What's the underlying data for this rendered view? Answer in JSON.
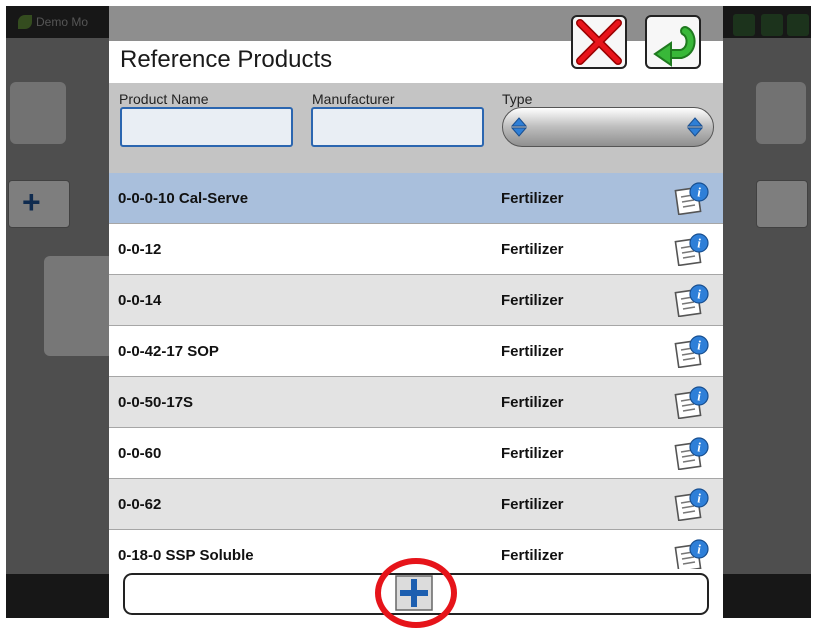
{
  "background_app": {
    "window_title": "Demo Mo"
  },
  "dialog": {
    "title": "Reference Products",
    "cancel_icon": "red-x-icon",
    "accept_icon": "green-return-arrow-icon",
    "filters": {
      "product_name_label": "Product Name",
      "product_name_value": "",
      "manufacturer_label": "Manufacturer",
      "manufacturer_value": "",
      "type_label": "Type",
      "type_value": ""
    },
    "rows": [
      {
        "name": "0-0-0-10 Cal-Serve",
        "type": "Fertilizer",
        "selected": true
      },
      {
        "name": "0-0-12",
        "type": "Fertilizer",
        "selected": false
      },
      {
        "name": "0-0-14",
        "type": "Fertilizer",
        "selected": false
      },
      {
        "name": "0-0-42-17 SOP",
        "type": "Fertilizer",
        "selected": false
      },
      {
        "name": "0-0-50-17S",
        "type": "Fertilizer",
        "selected": false
      },
      {
        "name": "0-0-60",
        "type": "Fertilizer",
        "selected": false
      },
      {
        "name": "0-0-62",
        "type": "Fertilizer",
        "selected": false
      },
      {
        "name": "0-18-0 SSP Soluble",
        "type": "Fertilizer",
        "selected": false
      }
    ],
    "info_icon": "product-info-icon",
    "add_icon": "plus-icon"
  },
  "colors": {
    "selected_row": "#a9bfdc",
    "alt_row": "#e3e3e3",
    "input_border": "#2b66b0",
    "highlight": "#e6141a"
  }
}
